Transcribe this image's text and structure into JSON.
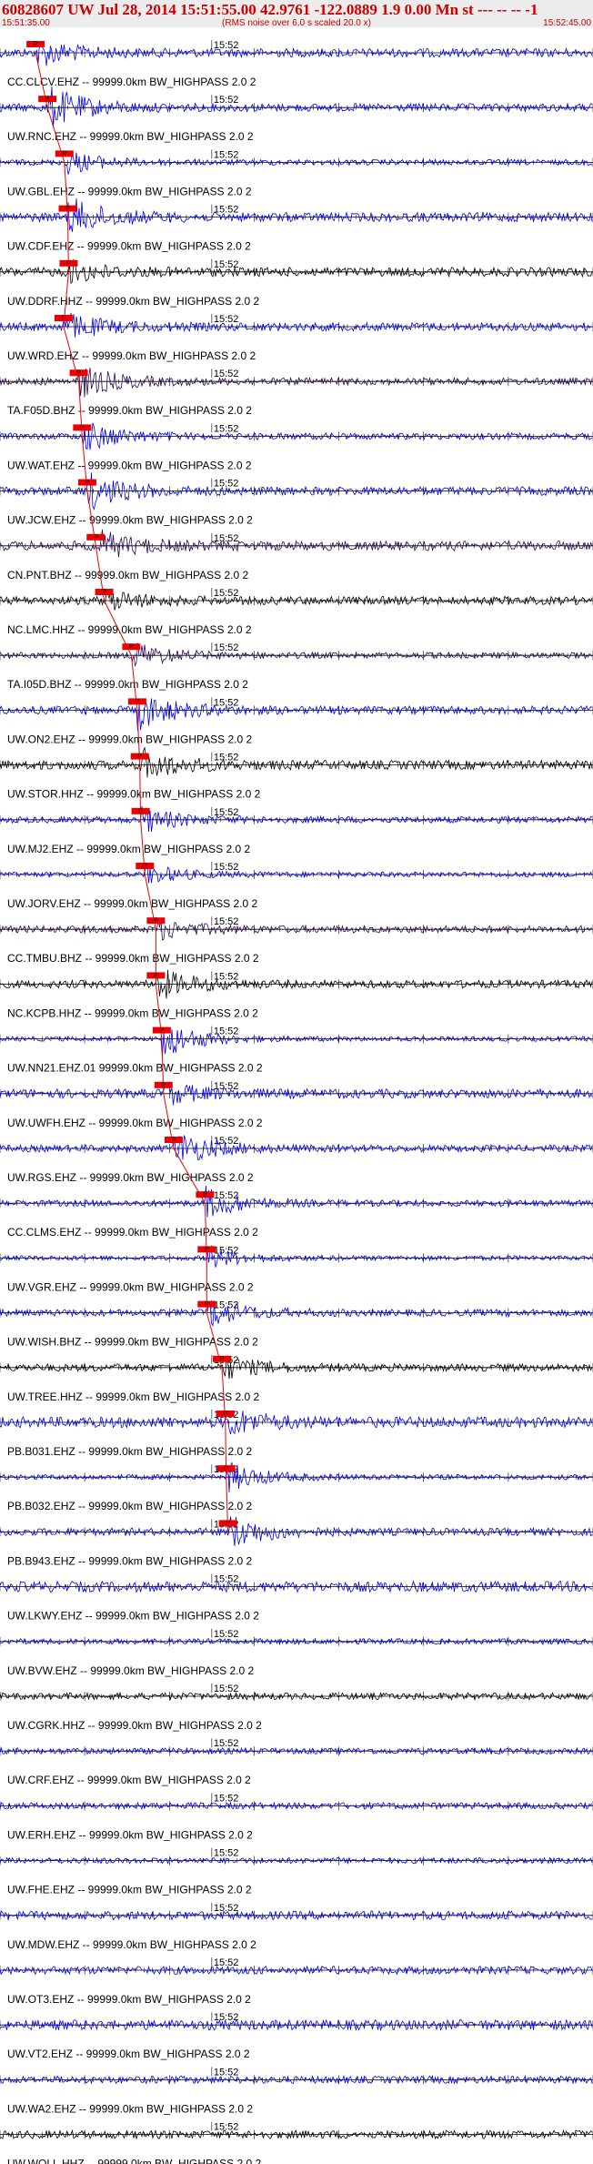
{
  "header": {
    "title": "60828607 UW Jul 28, 2014 15:51:55.00   42.9761 -122.0889  1.9 0.00 Mn st --- -- --  -1",
    "subtitle": "(RMS noise over 6.0 s scaled 20.0 x)",
    "start_time": "15:51:35.00",
    "end_time": "15:52:45.00",
    "title_color": "#cc0000"
  },
  "chart_data": {
    "type": "line",
    "title": "60828607 UW Jul 28, 2014 15:51:55.00   42.9761 -122.0889  1.9 0.00 Mn st --- -- --  -1",
    "xlabel": "",
    "ylabel": "",
    "x_range": [
      "15:51:35.00",
      "15:52:45.00"
    ],
    "minute_label": "15:52",
    "pick_label": "P",
    "colors": {
      "blue": "#0000ee",
      "black": "#000000",
      "purple": "#2a0a55",
      "pick": "#ee0000"
    },
    "series": [
      {
        "name": "CC.CLCV.EHZ -- 99999.0km BW_HIGHPASS  2.0  2",
        "color": "blue",
        "pick": 4.2
      },
      {
        "name": "UW.RNC.EHZ -- 99999.0km BW_HIGHPASS  2.0  2",
        "color": "blue",
        "pick": 5.6
      },
      {
        "name": "UW.GBL.EHZ -- 99999.0km BW_HIGHPASS  2.0  2",
        "color": "blue",
        "pick": 7.6
      },
      {
        "name": "UW.CDF.EHZ -- 99999.0km BW_HIGHPASS  2.0  2",
        "color": "blue",
        "pick": 8.0
      },
      {
        "name": "UW.DDRF.HHZ -- 99999.0km BW_HIGHPASS  2.0  2",
        "color": "black",
        "pick": 8.1
      },
      {
        "name": "UW.WRD.EHZ -- 99999.0km BW_HIGHPASS  2.0  2",
        "color": "blue",
        "pick": 7.5
      },
      {
        "name": "TA.F05D.BHZ -- 99999.0km BW_HIGHPASS  2.0  2",
        "color": "purple",
        "pick": 9.3
      },
      {
        "name": "UW.WAT.EHZ -- 99999.0km BW_HIGHPASS  2.0  2",
        "color": "blue",
        "pick": 9.7
      },
      {
        "name": "UW.JCW.EHZ -- 99999.0km BW_HIGHPASS  2.0  2",
        "color": "blue",
        "pick": 10.3
      },
      {
        "name": "CN.PNT.BHZ -- 99999.0km BW_HIGHPASS  2.0  2",
        "color": "purple",
        "pick": 11.3
      },
      {
        "name": "NC.LMC.HHZ -- 99999.0km BW_HIGHPASS  2.0  2",
        "color": "black",
        "pick": 12.3
      },
      {
        "name": "TA.I05D.BHZ -- 99999.0km BW_HIGHPASS  2.0  2",
        "color": "purple",
        "pick": 15.5
      },
      {
        "name": "UW.ON2.EHZ -- 99999.0km BW_HIGHPASS  2.0  2",
        "color": "blue",
        "pick": 16.2
      },
      {
        "name": "UW.STOR.HHZ -- 99999.0km BW_HIGHPASS  2.0  2",
        "color": "black",
        "pick": 16.5
      },
      {
        "name": "UW.MJ2.EHZ -- 99999.0km BW_HIGHPASS  2.0  2",
        "color": "blue",
        "pick": 16.6
      },
      {
        "name": "UW.JORV.EHZ -- 99999.0km BW_HIGHPASS  2.0  2",
        "color": "blue",
        "pick": 17.1
      },
      {
        "name": "CC.TMBU.BHZ -- 99999.0km BW_HIGHPASS  2.0  2",
        "color": "purple",
        "pick": 18.4
      },
      {
        "name": "NC.KCPB.HHZ -- 99999.0km BW_HIGHPASS  2.0  2",
        "color": "black",
        "pick": 18.4
      },
      {
        "name": "UW.NN21.EHZ.01 99999.0km BW_HIGHPASS  2.0  2",
        "color": "blue",
        "pick": 19.1
      },
      {
        "name": "UW.UWFH.EHZ -- 99999.0km BW_HIGHPASS  2.0  2",
        "color": "blue",
        "pick": 19.3
      },
      {
        "name": "UW.RGS.EHZ -- 99999.0km BW_HIGHPASS  2.0  2",
        "color": "blue",
        "pick": 20.5
      },
      {
        "name": "CC.CLMS.EHZ -- 99999.0km BW_HIGHPASS  2.0  2",
        "color": "blue",
        "pick": 24.2
      },
      {
        "name": "UW.VGR.EHZ -- 99999.0km BW_HIGHPASS  2.0  2",
        "color": "blue",
        "pick": 24.4
      },
      {
        "name": "UW.WISH.BHZ -- 99999.0km BW_HIGHPASS  2.0  2",
        "color": "blue",
        "pick": 24.4
      },
      {
        "name": "UW.TREE.HHZ -- 99999.0km BW_HIGHPASS  2.0  2",
        "color": "black",
        "pick": 26.2
      },
      {
        "name": "PB.B031.EHZ -- 99999.0km BW_HIGHPASS  2.0  2",
        "color": "blue",
        "pick": 26.6
      },
      {
        "name": "PB.B032.EHZ -- 99999.0km BW_HIGHPASS  2.0  2",
        "color": "blue",
        "pick": 26.7
      },
      {
        "name": "PB.B943.EHZ -- 99999.0km BW_HIGHPASS  2.0  2",
        "color": "blue",
        "pick": 26.9
      },
      {
        "name": "UW.LKWY.EHZ -- 99999.0km BW_HIGHPASS  2.0  2",
        "color": "blue",
        "pick": null
      },
      {
        "name": "UW.BVW.EHZ -- 99999.0km BW_HIGHPASS  2.0  2",
        "color": "blue",
        "pick": null
      },
      {
        "name": "UW.CGRK.HHZ -- 99999.0km BW_HIGHPASS  2.0  2",
        "color": "black",
        "pick": null
      },
      {
        "name": "UW.CRF.EHZ -- 99999.0km BW_HIGHPASS  2.0  2",
        "color": "blue",
        "pick": null
      },
      {
        "name": "UW.ERH.EHZ -- 99999.0km BW_HIGHPASS  2.0  2",
        "color": "blue",
        "pick": null
      },
      {
        "name": "UW.FHE.EHZ -- 99999.0km BW_HIGHPASS  2.0  2",
        "color": "blue",
        "pick": null
      },
      {
        "name": "UW.MDW.EHZ -- 99999.0km BW_HIGHPASS  2.0  2",
        "color": "blue",
        "pick": null
      },
      {
        "name": "UW.OT3.EHZ -- 99999.0km BW_HIGHPASS  2.0  2",
        "color": "blue",
        "pick": null
      },
      {
        "name": "UW.VT2.EHZ -- 99999.0km BW_HIGHPASS  2.0  2",
        "color": "blue",
        "pick": null
      },
      {
        "name": "UW.WA2.EHZ -- 99999.0km BW_HIGHPASS  2.0  2",
        "color": "blue",
        "pick": null
      },
      {
        "name": "UW.WOLL.HHZ -- 99999.0km BW_HIGHPASS  2.0  2",
        "color": "black",
        "pick": null
      }
    ]
  }
}
